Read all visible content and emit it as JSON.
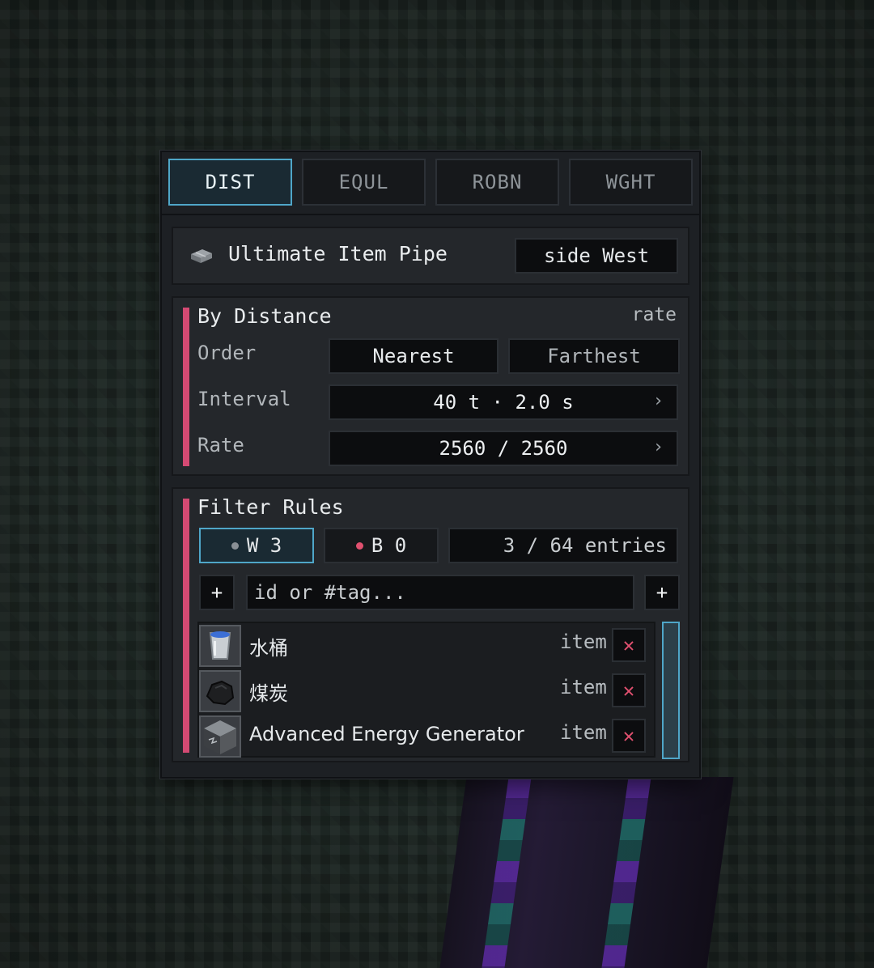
{
  "tabs": [
    {
      "label": "DIST",
      "active": true
    },
    {
      "label": "EQUL",
      "active": false
    },
    {
      "label": "ROBN",
      "active": false
    },
    {
      "label": "WGHT",
      "active": false
    }
  ],
  "header": {
    "icon": "pipe-icon",
    "title": "Ultimate Item Pipe",
    "side": "side West"
  },
  "distance": {
    "title": "By Distance",
    "rate_label": "rate",
    "accent_color": "#d44a73",
    "order": {
      "label": "Order",
      "options": [
        "Nearest",
        "Farthest"
      ],
      "selected": "Nearest"
    },
    "interval": {
      "label": "Interval",
      "value": "40 t · 2.0 s",
      "chevron": "›"
    },
    "rate": {
      "label": "Rate",
      "value": "2560 / 2560",
      "chevron": "›"
    }
  },
  "filter": {
    "title": "Filter Rules",
    "whitelist": {
      "label": "W 3",
      "dot_color": "#8a9096",
      "active": true
    },
    "blacklist": {
      "label": "B 0",
      "dot_color": "#e0506f"
    },
    "entries": "3 / 64 entries",
    "add_label": "+",
    "search_placeholder": "id or #tag...",
    "items": [
      {
        "name": "水桶",
        "type": "item",
        "icon": "water-bucket-icon",
        "delete": "✕"
      },
      {
        "name": "煤炭",
        "type": "item",
        "icon": "coal-icon",
        "delete": "✕"
      },
      {
        "name": "Advanced Energy Generator",
        "type": "item",
        "icon": "energy-generator-icon",
        "delete": "✕"
      }
    ]
  },
  "colors": {
    "accent_blue": "#4fa6c8",
    "accent_pink": "#d44a73",
    "panel_bg": "#1d2024"
  }
}
